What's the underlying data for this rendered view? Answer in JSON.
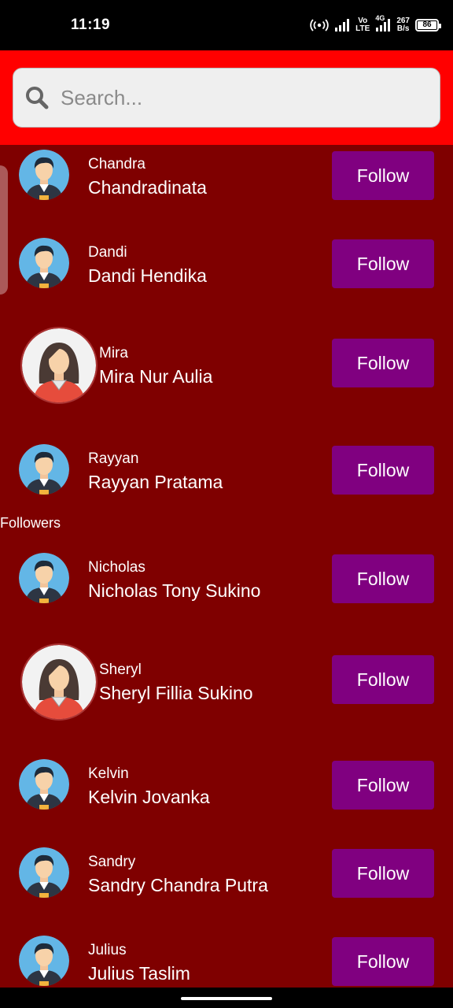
{
  "status_bar": {
    "time": "11:19",
    "hotspot_icon": "wifi-hotspot-icon",
    "volte": "Vo\nLTE",
    "network": "4G",
    "speed": "267\nB/s",
    "battery": "86"
  },
  "search": {
    "placeholder": "Search...",
    "icon": "search-icon"
  },
  "colors": {
    "header": "#ff0000",
    "background": "#7f0000",
    "button": "#800080"
  },
  "following": [
    {
      "username": "Chandra",
      "name": "Chandradinata",
      "button": "Follow",
      "avatar": "male"
    },
    {
      "username": "Dandi",
      "name": "Dandi Hendika",
      "button": "Follow",
      "avatar": "male"
    },
    {
      "username": "Mira",
      "name": "Mira Nur Aulia",
      "button": "Follow",
      "avatar": "female"
    },
    {
      "username": "Rayyan",
      "name": "Rayyan Pratama",
      "button": "Follow",
      "avatar": "male"
    }
  ],
  "followers_label": "Followers",
  "followers": [
    {
      "username": "Nicholas",
      "name": "Nicholas Tony Sukino",
      "button": "Follow",
      "avatar": "male"
    },
    {
      "username": "Sheryl",
      "name": "Sheryl Fillia Sukino",
      "button": "Follow",
      "avatar": "female"
    },
    {
      "username": "Kelvin",
      "name": "Kelvin Jovanka",
      "button": "Follow",
      "avatar": "male"
    },
    {
      "username": "Sandry",
      "name": "Sandry Chandra Putra",
      "button": "Follow",
      "avatar": "male"
    },
    {
      "username": "Julius",
      "name": "Julius Taslim",
      "button": "Follow",
      "avatar": "male"
    }
  ]
}
